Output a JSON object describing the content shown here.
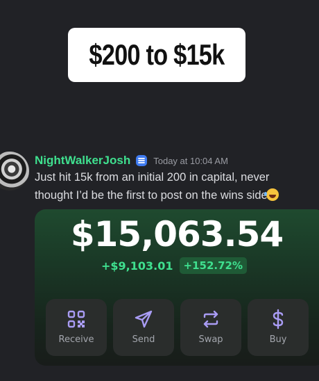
{
  "caption": "$200 to $15k",
  "message": {
    "username": "NightWalkerJosh",
    "timestamp": "Today at 10:04 AM",
    "text_line1": "Just hit 15k from an initial 200 in capital, never",
    "text_line2": "thought I’d be the first to post on the wins side",
    "emoji": "face-with-tears-of-joy"
  },
  "wallet": {
    "balance": "$15,063.54",
    "change_amount": "+$9,103.01",
    "change_percent": "+152.72%",
    "actions": [
      {
        "label": "Receive",
        "icon": "qr-code-icon"
      },
      {
        "label": "Send",
        "icon": "paper-plane-icon"
      },
      {
        "label": "Swap",
        "icon": "swap-arrows-icon"
      },
      {
        "label": "Buy",
        "icon": "dollar-icon"
      }
    ]
  },
  "colors": {
    "background": "#212226",
    "username": "#3fe08f",
    "gain": "#3fe08f",
    "icon_accent": "#a99cf4"
  }
}
